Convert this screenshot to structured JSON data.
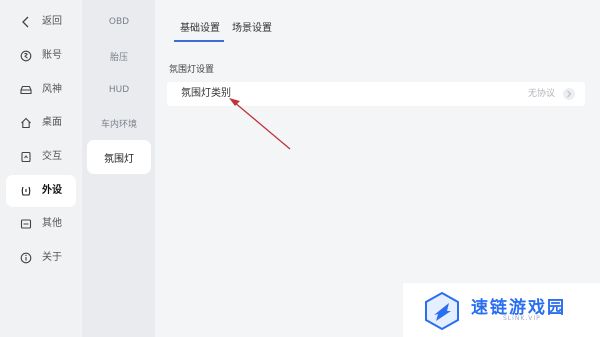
{
  "sidebar": {
    "items": [
      {
        "label": "返回",
        "icon": "back-arrow-icon"
      },
      {
        "label": "账号",
        "icon": "account-icon"
      },
      {
        "label": "风神",
        "icon": "car-icon"
      },
      {
        "label": "桌面",
        "icon": "home-icon"
      },
      {
        "label": "交互",
        "icon": "interaction-icon"
      },
      {
        "label": "外设",
        "icon": "peripheral-icon",
        "active": true
      },
      {
        "label": "其他",
        "icon": "other-icon"
      },
      {
        "label": "关于",
        "icon": "info-icon"
      }
    ]
  },
  "subnav": {
    "items": [
      {
        "label": "OBD"
      },
      {
        "label": "胎压"
      },
      {
        "label": "HUD"
      },
      {
        "label": "车内环境"
      },
      {
        "label": "氛围灯",
        "active": true
      }
    ]
  },
  "main": {
    "tabs": [
      {
        "label": "基础设置",
        "active": true
      },
      {
        "label": "场景设置"
      }
    ],
    "section_title": "氛围灯设置",
    "row": {
      "label": "氛围灯类别",
      "value": "无协议"
    }
  },
  "annotation": {
    "arrow_color": "#c0353a"
  },
  "watermark": {
    "title": "速链游戏园",
    "subtitle": "SLINK.VIP",
    "color": "#2a6ff0"
  }
}
